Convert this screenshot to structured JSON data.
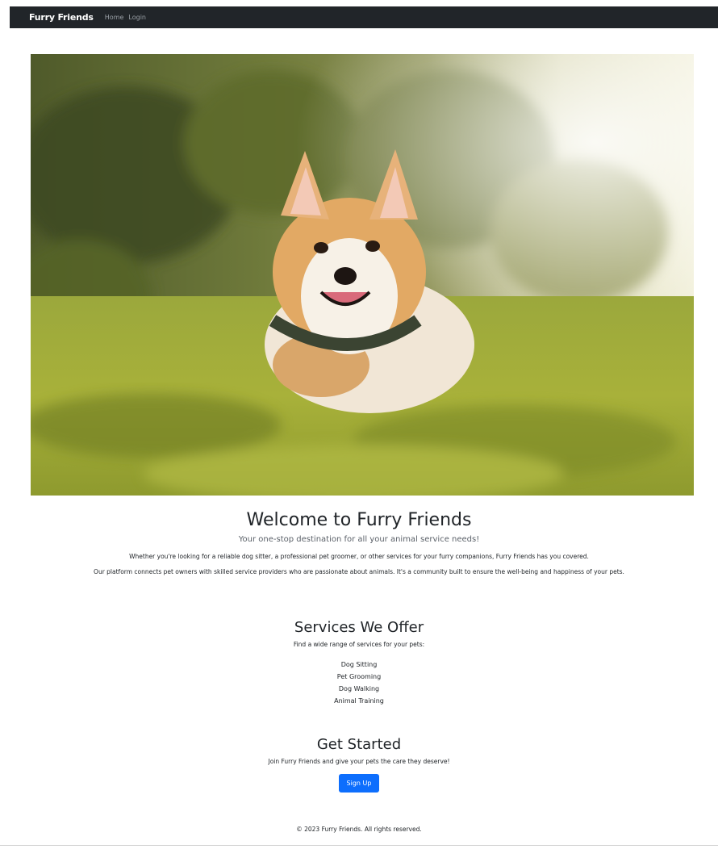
{
  "navbar": {
    "brand": "Furry Friends",
    "links": [
      "Home",
      "Login"
    ]
  },
  "hero": {
    "image_subject": "corgi-dog-in-grass"
  },
  "welcome": {
    "title": "Welcome to Furry Friends",
    "subtitle": "Your one-stop destination for all your animal service needs!",
    "paragraph1": "Whether you're looking for a reliable dog sitter, a professional pet groomer, or other services for your furry companions, Furry Friends has you covered.",
    "paragraph2": "Our platform connects pet owners with skilled service providers who are passionate about animals. It's a community built to ensure the well-being and happiness of your pets."
  },
  "services": {
    "title": "Services We Offer",
    "subtitle": "Find a wide range of services for your pets:",
    "items": [
      "Dog Sitting",
      "Pet Grooming",
      "Dog Walking",
      "Animal Training"
    ]
  },
  "get_started": {
    "title": "Get Started",
    "subtitle": "Join Furry Friends and give your pets the care they deserve!",
    "button_label": "Sign Up"
  },
  "footer": {
    "text": "© 2023 Furry Friends. All rights reserved."
  },
  "colors": {
    "navbar_bg": "#212529",
    "button_bg": "#0d6efd",
    "text": "#212529"
  }
}
